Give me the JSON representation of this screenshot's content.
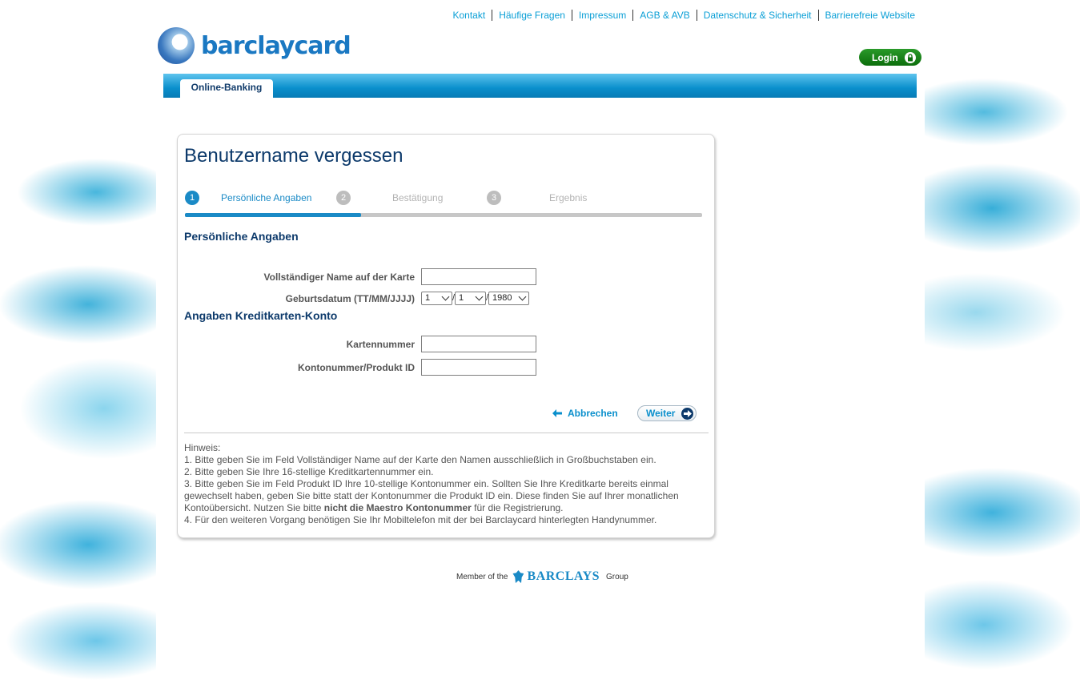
{
  "header": {
    "links": [
      "Kontakt",
      "Häufige Fragen",
      "Impressum",
      "AGB & AVB",
      "Datenschutz & Sicherheit",
      "Barrierefreie Website"
    ],
    "logo_text": "barclaycard",
    "login_label": "Login"
  },
  "nav": {
    "active_tab": "Online-Banking"
  },
  "form": {
    "title": "Benutzername vergessen",
    "steps": [
      {
        "number": "1",
        "label": "Persönliche Angaben",
        "active": true
      },
      {
        "number": "2",
        "label": "Bestätigung",
        "active": false
      },
      {
        "number": "3",
        "label": "Ergebnis",
        "active": false
      }
    ],
    "progress": 0.34,
    "section_personal": "Persönliche Angaben",
    "name_label": "Vollständiger Name auf der Karte",
    "name_value": "",
    "birthdate_label": "Geburtsdatum (TT/MM/JJJJ)",
    "birth_day": "1",
    "birth_month": "1",
    "birth_year": "1980",
    "date_separator": "/",
    "section_card": "Angaben Kreditkarten-Konto",
    "card_number_label": "Kartennummer",
    "card_number_value": "",
    "account_label": "Kontonummer/Produkt ID",
    "account_value": "",
    "cancel_label": "Abbrechen",
    "next_label": "Weiter"
  },
  "notes": {
    "heading": "Hinweis:",
    "line1": "1. Bitte geben Sie im Feld Vollständiger Name auf der Karte den Namen ausschließlich in Großbuchstaben ein.",
    "line2": "2. Bitte geben Sie Ihre 16-stellige Kreditkartennummer ein.",
    "line3_before": "3. Bitte geben Sie im  Feld Produkt ID Ihre 10-stellige Kontonummer ein. Sollten Sie Ihre Kreditkarte bereits einmal gewechselt haben, geben Sie bitte statt der Kontonummer die Produkt ID ein. Diese finden Sie auf Ihrer monatlichen Kontoübersicht. Nutzen Sie bitte ",
    "line3_bold": "nicht die Maestro Kontonummer",
    "line3_after": " für die Registrierung.",
    "line4": "4. Für den weiteren Vorgang benötigen Sie Ihr Mobiltelefon mit der bei Barclaycard hinterlegten Handynummer."
  },
  "footer": {
    "prefix": "Member of the",
    "brand": "BARCLAYS",
    "suffix": "Group"
  },
  "colors": {
    "accent": "#0a9fd6",
    "heading": "#0d3a6b",
    "login_green": "#0c6e0c"
  }
}
